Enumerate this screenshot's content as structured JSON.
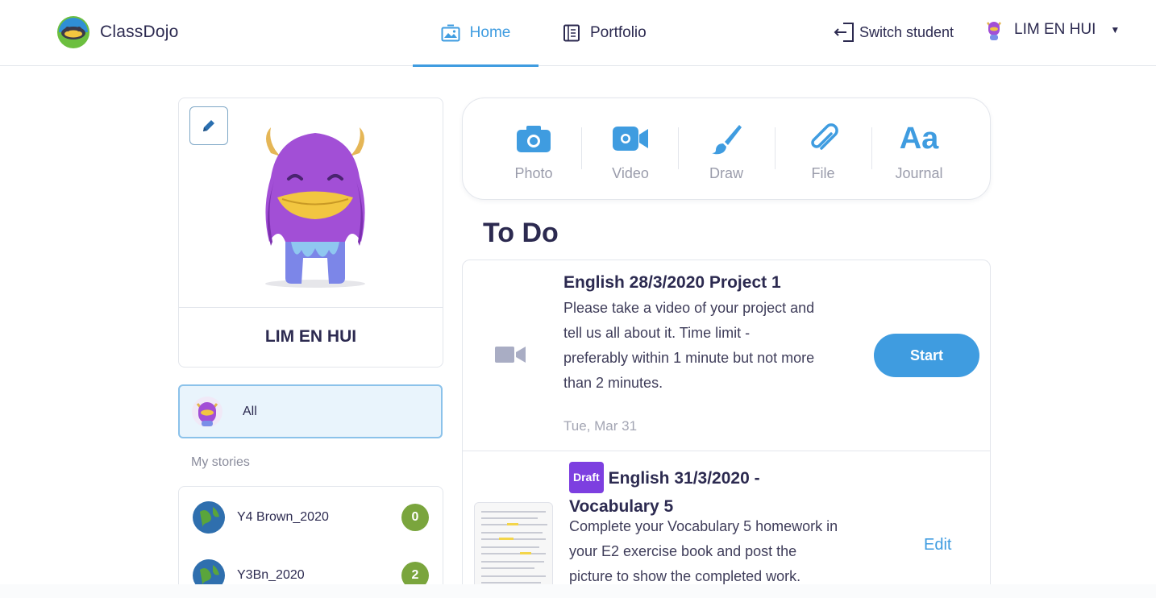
{
  "header": {
    "brand": "ClassDojo",
    "tabs": [
      {
        "label": "Home",
        "icon": "image-icon",
        "active": true
      },
      {
        "label": "Portfolio",
        "icon": "document-icon",
        "active": false
      }
    ],
    "switch_student": "Switch student",
    "user_name": "LIM EN HUI"
  },
  "profile": {
    "name": "LIM EN HUI"
  },
  "sidebar": {
    "all_label": "All",
    "my_stories_label": "My stories",
    "stories": [
      {
        "name": "Y4 Brown_2020",
        "count": "0"
      },
      {
        "name": "Y3Bn_2020",
        "count": "2"
      }
    ]
  },
  "post_bar": {
    "items": [
      {
        "label": "Photo",
        "icon": "camera-icon"
      },
      {
        "label": "Video",
        "icon": "video-camera-icon"
      },
      {
        "label": "Draw",
        "icon": "paintbrush-icon"
      },
      {
        "label": "File",
        "icon": "paperclip-icon"
      },
      {
        "label": "Journal",
        "icon": "text-aa-icon",
        "glyph": "Aa"
      }
    ]
  },
  "todo": {
    "title": "To Do",
    "tasks": [
      {
        "title": "English 28/3/2020 Project 1",
        "description_lines": [
          "Please take a video of your project and",
          "tell us all about it. Time limit -",
          "preferably within 1 minute but not more",
          "than 2 minutes."
        ],
        "date": "Tue, Mar 31",
        "action": "Start"
      },
      {
        "badge": "Draft",
        "title_line1": "English 31/3/2020 -",
        "title_line2": "Vocabulary 5",
        "description_lines": [
          "Complete your Vocabulary 5 homework in",
          "your E2 exercise book and post the",
          "picture to show the completed work."
        ],
        "action": "Edit"
      }
    ]
  },
  "colors": {
    "accent": "#3f9ce0",
    "text": "#2c2a50",
    "badge_green": "#7aa53d",
    "draft_purple": "#7d3fe0",
    "monster_purple": "#a24fd6"
  }
}
